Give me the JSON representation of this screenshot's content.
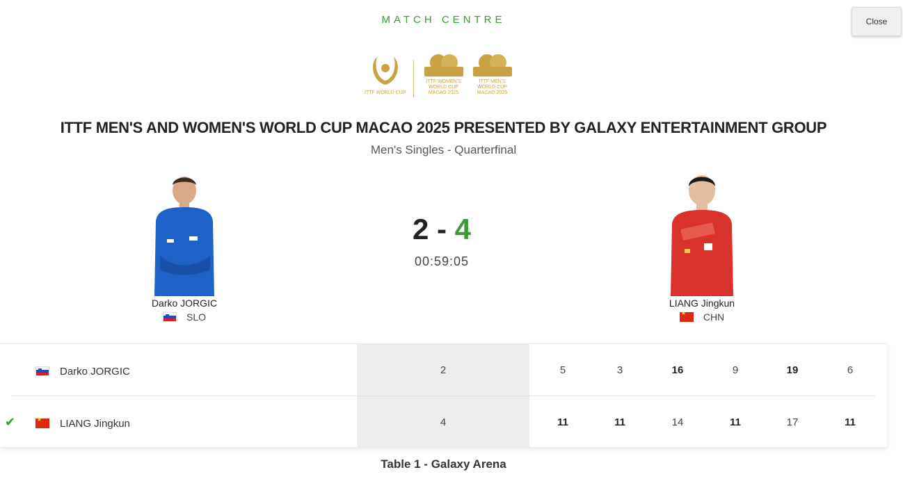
{
  "header": {
    "label": "MATCH CENTRE",
    "close_label": "Close"
  },
  "logos": {
    "world_cup_caption": "ITTF WORLD CUP",
    "women_caption": "ITTF WOMEN'S WORLD CUP MACAO 2025",
    "men_caption": "ITTF MEN'S WORLD CUP MACAO 2025",
    "gold_color": "#c9a343"
  },
  "event": {
    "title": "ITTF MEN'S AND WOMEN'S WORLD CUP MACAO 2025 PRESENTED BY GALAXY ENTERTAINMENT GROUP",
    "subtitle": "Men's Singles - Quarterfinal"
  },
  "players": {
    "home": {
      "name": "Darko JORGIC",
      "country": "SLO",
      "flag": "slovenia-flag"
    },
    "away": {
      "name": "LIANG Jingkun",
      "country": "CHN",
      "flag": "china-flag"
    }
  },
  "match": {
    "home_score": "2",
    "separator": "-",
    "away_score": "4",
    "duration": "00:59:05",
    "winner": "away",
    "accent_color": "#3a9a34"
  },
  "scoreboard": {
    "rows": [
      {
        "name": "Darko JORGIC",
        "games": "2",
        "points": [
          "5",
          "3",
          "16",
          "9",
          "19",
          "6"
        ],
        "winner": false
      },
      {
        "name": "LIANG Jingkun",
        "games": "4",
        "points": [
          "11",
          "11",
          "14",
          "11",
          "17",
          "11"
        ],
        "winner": true
      }
    ]
  },
  "venue": "Table 1 - Galaxy Arena"
}
